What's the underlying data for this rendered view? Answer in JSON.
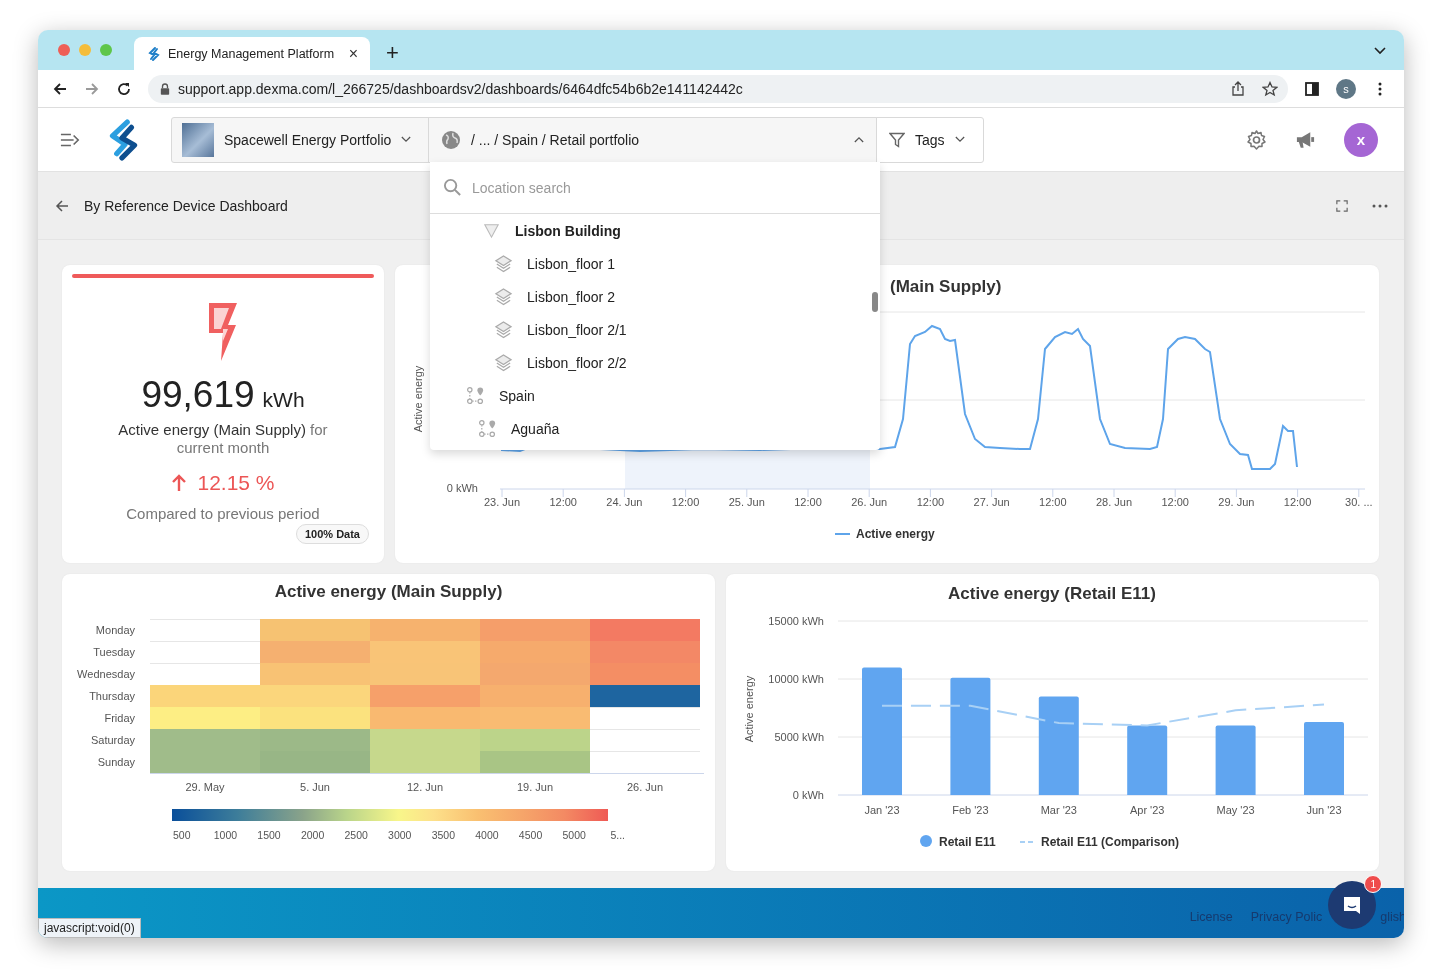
{
  "browser": {
    "tab": {
      "title": "Energy Management Platform",
      "close": "×"
    },
    "new_tab": "+",
    "url": "support.app.dexma.com/l_266725/dashboardsv2/dashboards/6464dfc54b6b2e141142442c",
    "profile": "s"
  },
  "header": {
    "portfolio": "Spacewell Energy Portfolio",
    "location": {
      "path": "/ ... / Spain / Retail portfolio",
      "expanded": true
    },
    "tags": "Tags",
    "avatar": "x"
  },
  "location_menu": {
    "placeholder": "Location search",
    "tree": [
      {
        "label": "Lisbon Building",
        "kind": "building",
        "children": [
          {
            "label": "Lisbon_floor 1",
            "kind": "floor"
          },
          {
            "label": "Lisbon_floor 2",
            "kind": "floor"
          },
          {
            "label": "Lisbon_floor 2/1",
            "kind": "floor"
          },
          {
            "label": "Lisbon_floor 2/2",
            "kind": "floor"
          }
        ]
      },
      {
        "label": "Spain",
        "kind": "region",
        "children": [
          {
            "label": "Aguaña",
            "kind": "region"
          }
        ]
      }
    ]
  },
  "dashboard": {
    "title": "By Reference Device Dashboard"
  },
  "kpi": {
    "value": "99,619",
    "unit": "kWh",
    "label": "Active energy (Main Supply)",
    "label_suffix": "for current month",
    "increase": true,
    "change": "12.15 %",
    "comparison": "Compared to previous period",
    "coverage": "100% Data"
  },
  "line_chart": {
    "title": "(Main Supply)",
    "ylabel": "Active energy",
    "ytick": "0 kWh",
    "legend": "Active energy",
    "xlabels": [
      "23. Jun",
      "12:00",
      "24. Jun",
      "12:00",
      "25. Jun",
      "12:00",
      "26. Jun",
      "12:00",
      "27. Jun",
      "12:00",
      "28. Jun",
      "12:00",
      "29. Jun",
      "12:00",
      "30. ..."
    ]
  },
  "heatmap": {
    "title": "Active energy (Main Supply)",
    "columns": [
      "29. May",
      "5. Jun",
      "12. Jun",
      "19. Jun",
      "26. Jun"
    ],
    "rows": [
      {
        "day": "Monday",
        "cells": [
          {},
          {
            "color": "#f6c272"
          },
          {
            "color": "#f6b26e"
          },
          {
            "color": "#f59e6a"
          },
          {
            "color": "#f37a62"
          }
        ]
      },
      {
        "day": "Tuesday",
        "cells": [
          {},
          {
            "color": "#f5b070"
          },
          {
            "color": "#f9c477"
          },
          {
            "color": "#f6aa6c"
          },
          {
            "color": "#f38866"
          }
        ]
      },
      {
        "day": "Wednesday",
        "cells": [
          {},
          {
            "color": "#f8c274"
          },
          {
            "color": "#f8c477"
          },
          {
            "color": "#f4a86e"
          },
          {
            "color": "#f48e64"
          }
        ]
      },
      {
        "day": "Thursday",
        "cells": [
          {
            "color": "#fbd57a"
          },
          {
            "color": "#fbd67c"
          },
          {
            "color": "#f6a06a"
          },
          {
            "color": "#f7b06e"
          },
          {
            "color": "#1e65a0"
          }
        ]
      },
      {
        "day": "Friday",
        "cells": [
          {
            "color": "#fdee84"
          },
          {
            "color": "#fbe27e"
          },
          {
            "color": "#f9b970"
          },
          {
            "color": "#f9bb72"
          },
          {}
        ]
      },
      {
        "day": "Saturday",
        "cells": [
          {
            "color": "#a0bc8a"
          },
          {
            "color": "#9cb988"
          },
          {
            "color": "#c6d88c"
          },
          {
            "color": "#bcd48a"
          },
          {}
        ]
      },
      {
        "day": "Sunday",
        "cells": [
          {
            "color": "#a0bc8a"
          },
          {
            "color": "#98b686"
          },
          {
            "color": "#c6d88c"
          },
          {
            "color": "#a9c585"
          },
          {}
        ]
      }
    ],
    "scale_labels": [
      "500",
      "1000",
      "1500",
      "2000",
      "2500",
      "3000",
      "3500",
      "4000",
      "4500",
      "5000",
      "5..."
    ]
  },
  "bar_chart": {
    "title": "Active energy (Retail E11)",
    "chart_data": {
      "type": "bar",
      "ylabel": "Active energy",
      "categories": [
        "Jan '23",
        "Feb '23",
        "Mar '23",
        "Apr '23",
        "May '23",
        "Jun '23"
      ],
      "ylim": [
        0,
        15000
      ],
      "legend": "bottom",
      "yticks": [
        {
          "value": 0,
          "label": "0 kWh"
        },
        {
          "value": 5000,
          "label": "5000 kWh"
        },
        {
          "value": 10000,
          "label": "10000 kWh"
        },
        {
          "value": 15000,
          "label": "15000 kWh"
        }
      ],
      "series": [
        {
          "name": "Retail E11",
          "type": "bar",
          "color": "#60a5f0",
          "values": [
            11000,
            10100,
            8500,
            6000,
            6000,
            6300
          ]
        },
        {
          "name": "Retail E11 (Comparison)",
          "type": "line",
          "line_style": "dashed",
          "color": "#a8d0f5",
          "values": [
            7700,
            7700,
            6200,
            6000,
            7300,
            7800
          ]
        }
      ]
    }
  },
  "footer": {
    "links": [
      "License",
      "Privacy Polic",
      "glish"
    ],
    "chat_badge": "1"
  },
  "status_link": "javascript:void(0)"
}
